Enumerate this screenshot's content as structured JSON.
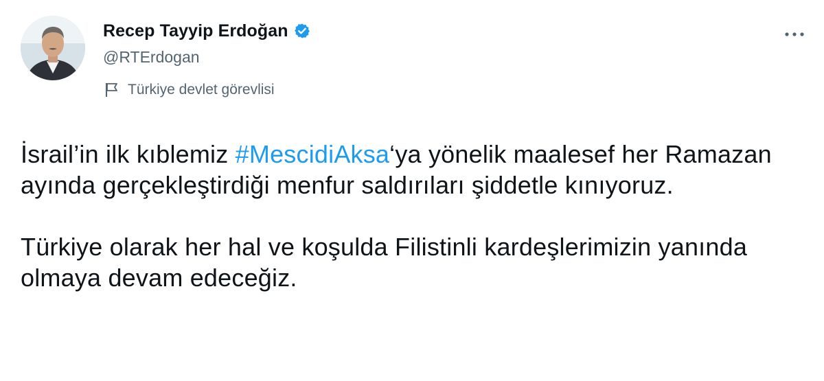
{
  "author": {
    "display_name": "Recep Tayyip Erdoğan",
    "handle": "@RTErdogan",
    "verified": true,
    "label": "Türkiye devlet görevlisi"
  },
  "tweet": {
    "para1_before": "İsrail’in ilk kıblemiz ",
    "hashtag": "#MescidiAksa",
    "para1_after": "‘ya yönelik maalesef her Ramazan ayında gerçekleştirdiği menfur saldırıları şiddetle kınıyoruz.",
    "para2": "Türkiye olarak her hal ve koşulda Filistinli kardeşlerimizin yanında olmaya devam edeceğiz."
  },
  "icons": {
    "verified": "verified-badge-icon",
    "label": "flag-icon",
    "more": "more-options-icon"
  },
  "colors": {
    "accent": "#1d9bf0",
    "secondary_text": "#536471",
    "primary_text": "#0f1419"
  }
}
